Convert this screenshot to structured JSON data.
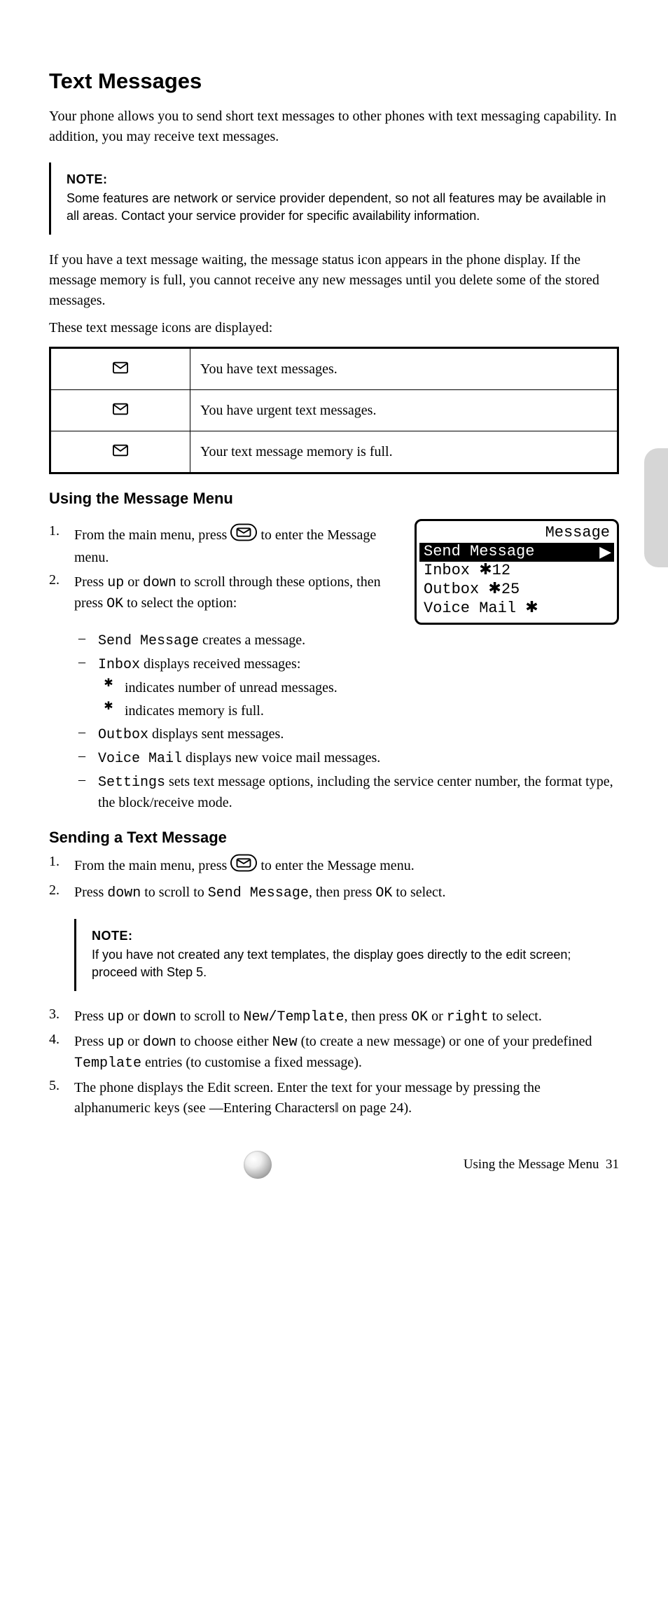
{
  "page": {
    "section_title": "Text Messages",
    "intro_p1": "Your phone allows you to send short text messages to other phones with text messaging capability. In addition, you may receive text messages.",
    "intro_p2": "If you have a text message waiting, the message status icon appears in the phone display. If the message memory is full, you cannot receive any new messages until you delete some of the stored messages.",
    "intro_p3": "These text message icons are displayed:",
    "env_plain_label": "(envelope)",
    "footer_page": "31",
    "footer_text": "Using the Message Menu"
  },
  "note1": {
    "label": "NOTE:",
    "text": "Some features are network or service provider dependent, so not all features may be available in all areas. Contact your service provider for specific availability information."
  },
  "icon_table": {
    "r1_desc": "You have text messages.",
    "r2_desc": "You have urgent text messages.",
    "r3_desc": "Your text message memory is full."
  },
  "use_menu": {
    "heading": "Using the Message Menu",
    "step1_n": "1.",
    "step1_t_pre": "From the main menu, press ",
    "step1_t_post": " to enter the Message menu.",
    "step2_n": "2.",
    "step2_t_pre": "Press ",
    "step2_key_up": "up",
    "step2_or": " or ",
    "step2_key_down": "down",
    "step2_t_post": " to scroll through these options, then press ",
    "step2_key_ok": "OK",
    "step2_t_end": " to select the option:",
    "screen": {
      "title": "Message",
      "row_hl": "Send Message",
      "row2": "Inbox ✱12",
      "row3": "Outbox ✱25",
      "row4": "Voice Mail ✱"
    },
    "li_send": "Send Message",
    "li_send_desc": "creates a message.",
    "li_inbox": "Inbox",
    "li_inbox_desc": "displays received messages:",
    "li_inbox_sub1": "indicates number of unread messages.",
    "li_inbox_sub2": "indicates memory is full.",
    "li_outbox": "Outbox",
    "li_outbox_desc": "displays sent messages.",
    "li_vm": "Voice Mail",
    "li_vm_desc": "displays new voice mail messages.",
    "li_settings": "Settings",
    "li_settings_desc": "sets text message options, including the service center number, the format type, the block/receive mode."
  },
  "send_msg": {
    "heading": "Sending a Text Message",
    "step1_n": "1.",
    "step1_pre": "From the main menu, press ",
    "step1_post": " to enter the Message menu.",
    "step2_n": "2.",
    "step2_pre": "Press ",
    "step2_down": "down",
    "step2_mid": " to scroll to ",
    "step2_target": "Send Message",
    "step2_then": ", then press ",
    "step2_ok": "OK",
    "step2_end": " to select.",
    "note2_label": "NOTE:",
    "note2_text": "If you have not created any text templates, the display goes directly to the edit screen; proceed with Step 5.",
    "step3_n": "3.",
    "step3_pre": "Press ",
    "step3_up": "up",
    "step3_or": " or ",
    "step3_down": "down",
    "step3_mid": " to scroll to ",
    "step3_new": "New/Template",
    "step3_then": ", then press ",
    "step3_ok": "OK",
    "step3_end": " or ",
    "step3_right": "right",
    "step3_tail": " to select.",
    "step4_n": "4.",
    "step4_pre": "Press ",
    "step4_up": "up",
    "step4_or": " or ",
    "step4_down": "down",
    "step4_mid": " to choose either ",
    "step4_new": "New",
    "step4_mid2": " (to create a new message) or one of your predefined ",
    "step4_tmpl": "Template",
    "step4_mid3": " entries (to customise a fixed message).",
    "step5_n": "5.",
    "step5_pre": "The phone displays the Edit screen. Enter the text for your message by pressing the alphanumeric keys (see ",
    "step5_link": "―Entering Characters‖",
    "step5_pg": " on page 24)."
  }
}
